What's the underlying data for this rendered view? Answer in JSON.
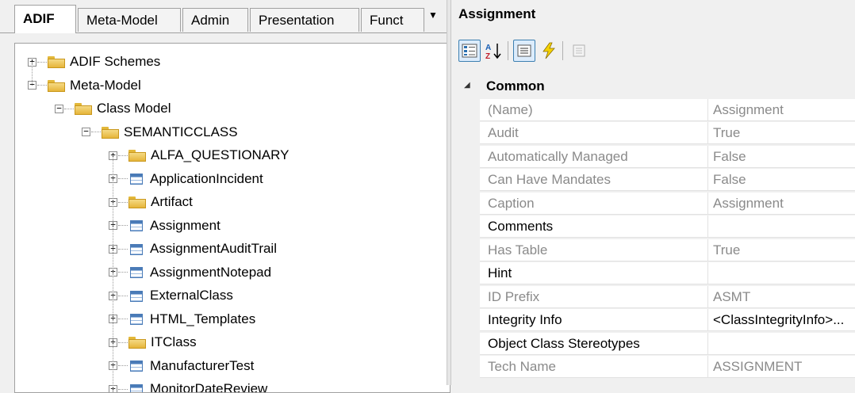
{
  "tabs": [
    "ADIF",
    "Meta-Model",
    "Admin",
    "Presentation",
    "Funct"
  ],
  "tree": {
    "items": [
      {
        "label": "ADIF Schemes",
        "icon": "folder-icon",
        "expander": "+"
      },
      {
        "label": "Meta-Model",
        "icon": "folder-icon",
        "expander": "-"
      },
      {
        "label": "Class Model",
        "icon": "folder-icon",
        "expander": "-"
      },
      {
        "label": "SEMANTICCLASS",
        "icon": "folder-icon",
        "expander": "-"
      },
      {
        "label": "ALFA_QUESTIONARY",
        "icon": "folder-icon",
        "expander": "+"
      },
      {
        "label": "ApplicationIncident",
        "icon": "table-icon",
        "expander": "+"
      },
      {
        "label": "Artifact",
        "icon": "folder-icon",
        "expander": "+"
      },
      {
        "label": "Assignment",
        "icon": "table-icon",
        "expander": "+"
      },
      {
        "label": "AssignmentAuditTrail",
        "icon": "table-icon",
        "expander": "+"
      },
      {
        "label": "AssignmentNotepad",
        "icon": "table-icon",
        "expander": "+"
      },
      {
        "label": "ExternalClass",
        "icon": "table-icon",
        "expander": "+"
      },
      {
        "label": "HTML_Templates",
        "icon": "table-icon",
        "expander": "+"
      },
      {
        "label": "ITClass",
        "icon": "folder-icon",
        "expander": "+"
      },
      {
        "label": "ManufacturerTest",
        "icon": "table-icon",
        "expander": "+"
      },
      {
        "label": "MonitorDateReview",
        "icon": "table-icon",
        "expander": "+"
      }
    ]
  },
  "properties": {
    "title": "Assignment",
    "toolbar": [
      "categorized-icon",
      "alphabetical-icon",
      "properties-icon",
      "events-icon",
      "property-pages-icon"
    ],
    "category": "Common",
    "rows": [
      {
        "name": "(Name)",
        "value": "Assignment",
        "editable": false
      },
      {
        "name": "Audit",
        "value": "True",
        "editable": false
      },
      {
        "name": "Automatically Managed",
        "value": "False",
        "editable": false
      },
      {
        "name": "Can Have Mandates",
        "value": "False",
        "editable": false
      },
      {
        "name": "Caption",
        "value": "Assignment",
        "editable": false
      },
      {
        "name": "Comments",
        "value": "",
        "editable": true
      },
      {
        "name": "Has Table",
        "value": "True",
        "editable": false
      },
      {
        "name": "Hint",
        "value": "",
        "editable": true
      },
      {
        "name": "ID Prefix",
        "value": "ASMT",
        "editable": false
      },
      {
        "name": "Integrity Info",
        "value": "<ClassIntegrityInfo>...",
        "editable": true
      },
      {
        "name": "Object Class Stereotypes",
        "value": "",
        "editable": true
      },
      {
        "name": "Tech Name",
        "value": "ASSIGNMENT",
        "editable": false
      }
    ]
  }
}
